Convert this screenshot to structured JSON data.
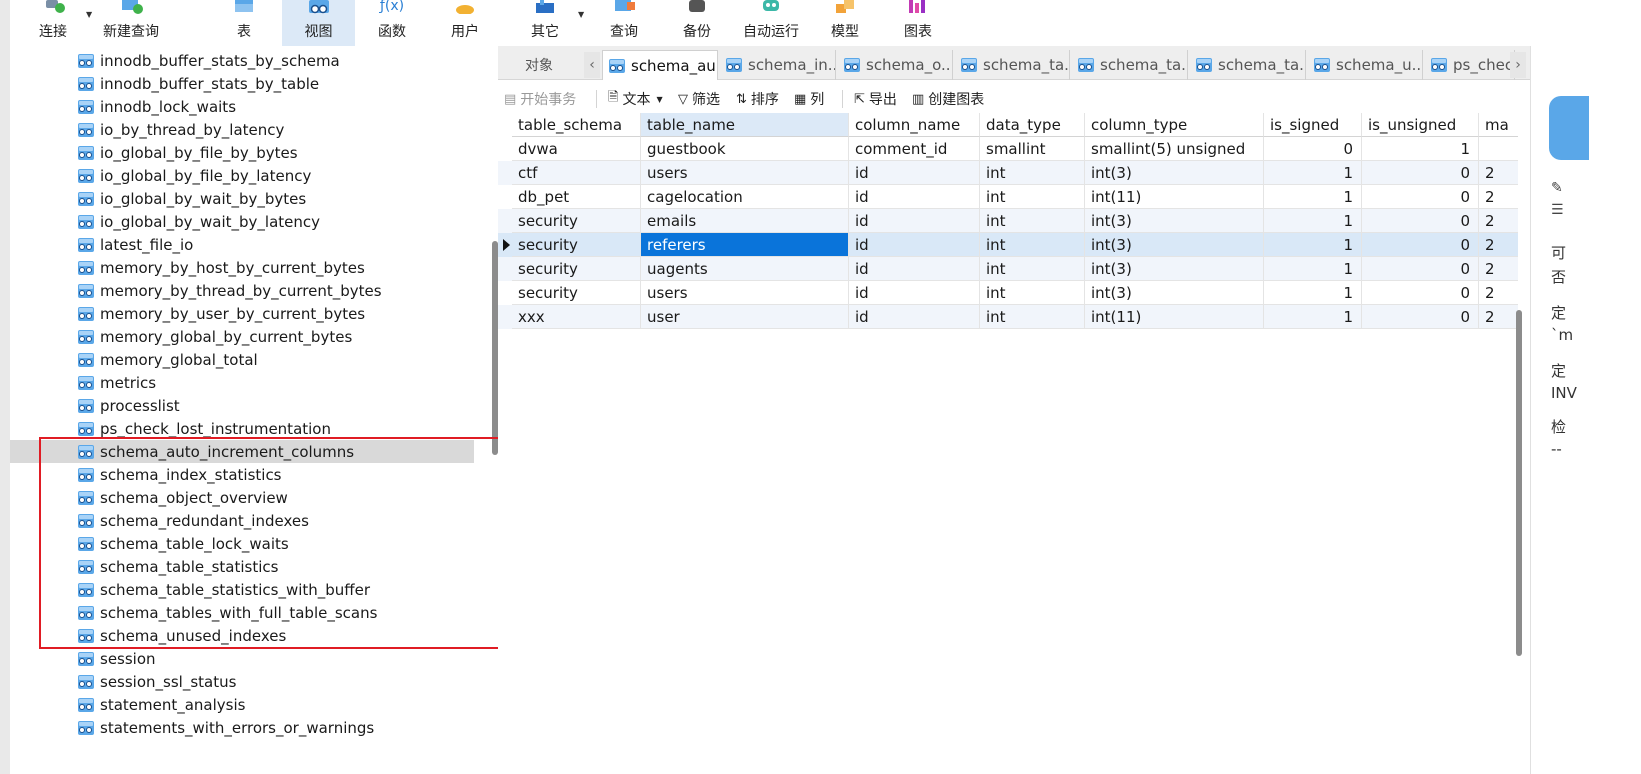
{
  "toolbar": {
    "buttons": [
      {
        "label": "连接",
        "icon": "plug-icon"
      },
      {
        "label": "新建查询",
        "icon": "new-query-icon"
      },
      {
        "label": "表",
        "icon": "table-icon"
      },
      {
        "label": "视图",
        "icon": "view-icon",
        "active": true
      },
      {
        "label": "函数",
        "icon": "function-icon",
        "glyph": "ƒ(x)"
      },
      {
        "label": "用户",
        "icon": "user-icon"
      },
      {
        "label": "其它",
        "icon": "other-icon"
      },
      {
        "label": "查询",
        "icon": "query-icon"
      },
      {
        "label": "备份",
        "icon": "backup-icon"
      },
      {
        "label": "自动运行",
        "icon": "robot-icon"
      },
      {
        "label": "模型",
        "icon": "model-icon"
      },
      {
        "label": "图表",
        "icon": "chart-icon"
      }
    ]
  },
  "navigator": {
    "items": [
      "innodb_buffer_stats_by_schema",
      "innodb_buffer_stats_by_table",
      "innodb_lock_waits",
      "io_by_thread_by_latency",
      "io_global_by_file_by_bytes",
      "io_global_by_file_by_latency",
      "io_global_by_wait_by_bytes",
      "io_global_by_wait_by_latency",
      "latest_file_io",
      "memory_by_host_by_current_bytes",
      "memory_by_thread_by_current_bytes",
      "memory_by_user_by_current_bytes",
      "memory_global_by_current_bytes",
      "memory_global_total",
      "metrics",
      "processlist",
      "ps_check_lost_instrumentation",
      "schema_auto_increment_columns",
      "schema_index_statistics",
      "schema_object_overview",
      "schema_redundant_indexes",
      "schema_table_lock_waits",
      "schema_table_statistics",
      "schema_table_statistics_with_buffer",
      "schema_tables_with_full_table_scans",
      "schema_unused_indexes",
      "session",
      "session_ssl_status",
      "statement_analysis",
      "statements_with_errors_or_warnings"
    ],
    "selected_item": "schema_auto_increment_columns"
  },
  "tabs": {
    "objects_label": "对象",
    "items": [
      {
        "label": "schema_au...",
        "active": true
      },
      {
        "label": "schema_in..."
      },
      {
        "label": "schema_o..."
      },
      {
        "label": "schema_ta..."
      },
      {
        "label": "schema_ta..."
      },
      {
        "label": "schema_ta..."
      },
      {
        "label": "schema_u..."
      },
      {
        "label": "ps_chec"
      }
    ]
  },
  "data_toolbar": {
    "begin_transaction": "开始事务",
    "text": "文本",
    "filter": "筛选",
    "sort": "排序",
    "columns": "列",
    "export": "导出",
    "create_chart": "创建图表"
  },
  "grid": {
    "columns": [
      "table_schema",
      "table_name",
      "column_name",
      "data_type",
      "column_type",
      "is_signed",
      "is_unsigned",
      "ma"
    ],
    "rows": [
      [
        "dvwa",
        "guestbook",
        "comment_id",
        "smallint",
        "smallint(5) unsigned",
        "0",
        "1",
        ""
      ],
      [
        "ctf",
        "users",
        "id",
        "int",
        "int(3)",
        "1",
        "0",
        "2"
      ],
      [
        "db_pet",
        "cagelocation",
        "id",
        "int",
        "int(11)",
        "1",
        "0",
        "2"
      ],
      [
        "security",
        "emails",
        "id",
        "int",
        "int(3)",
        "1",
        "0",
        "2"
      ],
      [
        "security",
        "referers",
        "id",
        "int",
        "int(3)",
        "1",
        "0",
        "2"
      ],
      [
        "security",
        "uagents",
        "id",
        "int",
        "int(3)",
        "1",
        "0",
        "2"
      ],
      [
        "security",
        "users",
        "id",
        "int",
        "int(3)",
        "1",
        "0",
        "2"
      ],
      [
        "xxx",
        "user",
        "id",
        "int",
        "int(11)",
        "1",
        "0",
        "2"
      ]
    ],
    "current_row": 4,
    "selected_cell": "referers"
  },
  "right_panel": {
    "lines": [
      "可",
      "否",
      "定",
      "`m",
      "定",
      "INV",
      "检",
      "--"
    ]
  },
  "colors": {
    "accent": "#0a74da",
    "highlight_box": "#e01c24",
    "active_toolbar": "#dce9f7"
  }
}
